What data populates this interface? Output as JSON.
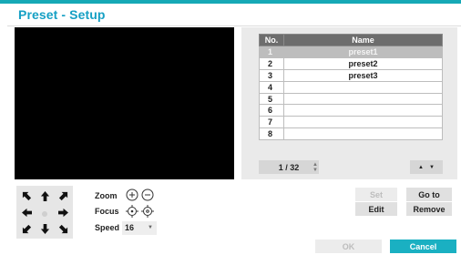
{
  "dialog": {
    "title": "Preset - Setup"
  },
  "colors": {
    "accent": "#16a9b6",
    "title": "#16a0c4",
    "primary_button": "#1ab0c2"
  },
  "preset_table": {
    "headers": {
      "no": "No.",
      "name": "Name"
    },
    "rows": [
      {
        "no": "1",
        "name": "preset1",
        "selected": true
      },
      {
        "no": "2",
        "name": "preset2"
      },
      {
        "no": "3",
        "name": "preset3"
      },
      {
        "no": "4",
        "name": ""
      },
      {
        "no": "5",
        "name": ""
      },
      {
        "no": "6",
        "name": ""
      },
      {
        "no": "7",
        "name": ""
      },
      {
        "no": "8",
        "name": ""
      }
    ]
  },
  "pager": {
    "text": "1 / 32"
  },
  "ptz": {
    "zoom_label": "Zoom",
    "focus_label": "Focus",
    "speed_label": "Speed",
    "speed_value": "16",
    "icons": [
      "arrow-up-left-icon",
      "arrow-up-icon",
      "arrow-up-right-icon",
      "arrow-left-icon",
      "center-dot-icon",
      "arrow-right-icon",
      "arrow-down-left-icon",
      "arrow-down-icon",
      "arrow-down-right-icon"
    ]
  },
  "buttons": {
    "set": "Set",
    "goto": "Go to",
    "edit": "Edit",
    "remove": "Remove",
    "ok": "OK",
    "cancel": "Cancel"
  }
}
